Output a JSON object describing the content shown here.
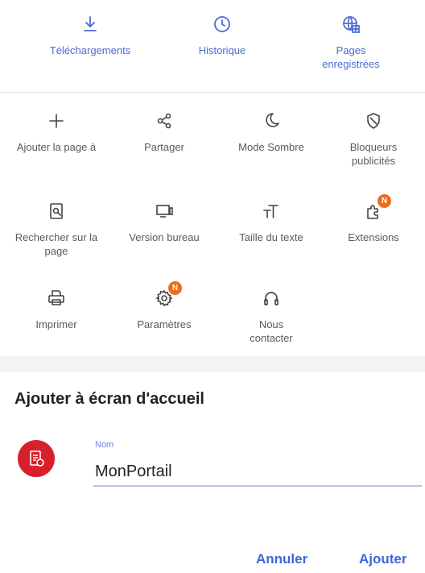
{
  "top_row": [
    {
      "label": "Téléchargements",
      "icon": "download-icon"
    },
    {
      "label": "Historique",
      "icon": "clock-icon"
    },
    {
      "label": "Pages enregistrées",
      "icon": "globe-save-icon"
    }
  ],
  "grid": [
    {
      "label": "Ajouter la page à",
      "icon": "plus-icon"
    },
    {
      "label": "Partager",
      "icon": "share-icon"
    },
    {
      "label": "Mode Sombre",
      "icon": "moon-icon"
    },
    {
      "label": "Bloqueurs publicités",
      "icon": "shield-icon"
    },
    {
      "label": "Rechercher sur la page",
      "icon": "find-in-page-icon"
    },
    {
      "label": "Version bureau",
      "icon": "desktop-icon"
    },
    {
      "label": "Taille du texte",
      "icon": "text-size-icon"
    },
    {
      "label": "Extensions",
      "icon": "extensions-icon",
      "badge": "N"
    },
    {
      "label": "Imprimer",
      "icon": "printer-icon"
    },
    {
      "label": "Paramètres",
      "icon": "gear-icon",
      "badge": "N"
    },
    {
      "label": "Nous contacter",
      "icon": "headset-icon"
    }
  ],
  "dialog": {
    "title": "Ajouter à écran d'accueil",
    "field_label": "Nom",
    "field_value": "MonPortail",
    "cancel_label": "Annuler",
    "add_label": "Ajouter"
  },
  "colors": {
    "accent": "#3f66d6",
    "badge": "#ef6a1a",
    "app_icon": "#d8202c"
  }
}
